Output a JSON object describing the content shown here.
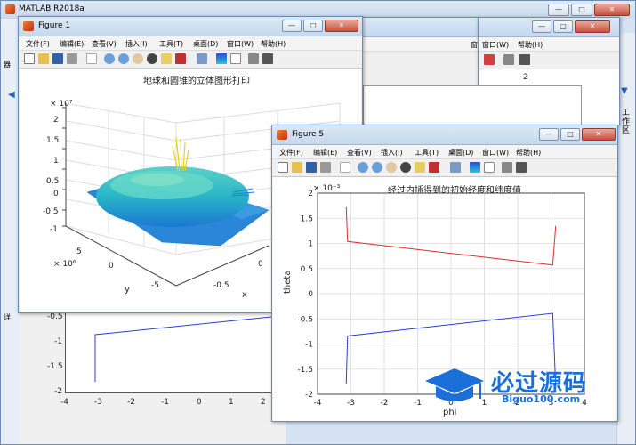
{
  "app": {
    "title": "MATLAB R2018a",
    "controls": {
      "minimize": "—",
      "maximize": "□",
      "close": "✕"
    }
  },
  "matlab_bg": {
    "side_labels": [
      "工",
      "作",
      "区"
    ],
    "left_glyphs": [
      "器",
      "详"
    ],
    "bg_plot_ticks_y": [
      "-0.5",
      "-1",
      "-1.5",
      "-2"
    ],
    "bg_plot_ticks_x": [
      "-4",
      "-3",
      "-2",
      "-1",
      "0",
      "1",
      "2"
    ],
    "bg_fig_label": "2"
  },
  "menus": [
    "文件(F)",
    "编辑(E)",
    "查看(V)",
    "插入(I)",
    "工具(T)",
    "桌面(D)",
    "窗口(W)",
    "帮助(H)"
  ],
  "back_figure": {
    "menus": [
      "窗口(W)",
      "帮助(H)"
    ],
    "axis_label": "2"
  },
  "figure1": {
    "title": "Figure 1",
    "plot_title": "地球和圆锥的立体图形打印",
    "z_exponent": "× 10⁷",
    "z_ticks": [
      "2",
      "1.5",
      "1",
      "0.5",
      "0",
      "-0.5",
      "-1"
    ],
    "y_exponent": "× 10⁶",
    "y_ticks": [
      "5",
      "0",
      "-5"
    ],
    "x_ticks": [
      "-0.5",
      "0"
    ],
    "ylabel": "y",
    "xlabel": "x"
  },
  "figure5": {
    "title": "Figure 5",
    "plot_title": "经过内插得到的初始经度和纬度值",
    "y_exponent": "× 10⁻³",
    "ylabel": "theta",
    "xlabel": "phi",
    "colors": {
      "upper": "#e03030",
      "lower": "#2a3fd8"
    }
  },
  "chart_data": {
    "type": "line",
    "title": "经过内插得到的初始经度和纬度值",
    "xlabel": "phi",
    "ylabel": "theta",
    "y_scale_label": "× 10⁻³",
    "xlim": [
      -4,
      4
    ],
    "ylim": [
      -2,
      2
    ],
    "x_ticks": [
      -4,
      -3,
      -2,
      -1,
      0,
      1,
      2,
      3,
      4
    ],
    "y_ticks": [
      2,
      1.5,
      1,
      0.5,
      0,
      -0.5,
      -1,
      -1.5,
      -2
    ],
    "grid": true,
    "series": [
      {
        "color": "#e03030",
        "x": [
          -3.14,
          -3.1,
          3.05,
          3.14
        ],
        "y": [
          1.72,
          1.04,
          0.57,
          1.35
        ]
      },
      {
        "color": "#2a3fd8",
        "x": [
          -3.14,
          -3.1,
          3.05,
          3.14
        ],
        "y": [
          -1.8,
          -0.84,
          -0.39,
          -1.85
        ]
      }
    ]
  },
  "watermark": {
    "title": "必过源码",
    "site": "Biguo100.com"
  }
}
